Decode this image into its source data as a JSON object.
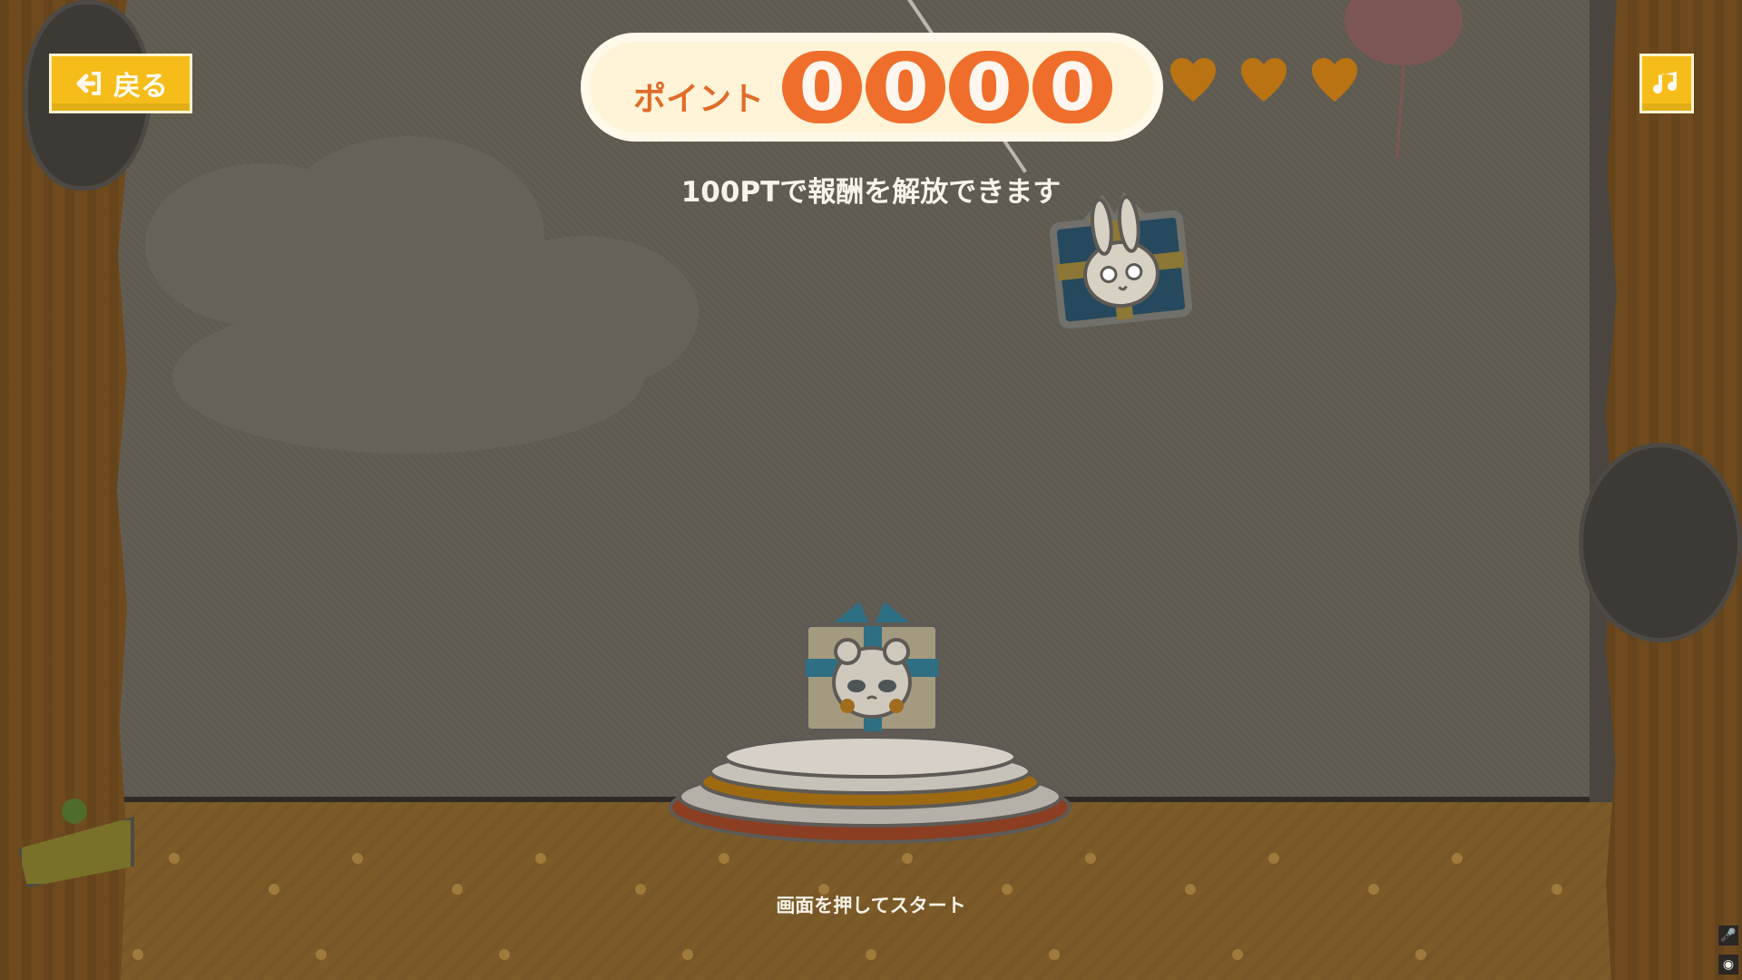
{
  "header": {
    "back_label": "戻る",
    "points_label": "ポイント",
    "points_digits": [
      "0",
      "0",
      "0",
      "0"
    ],
    "reward_hint": "100PTで報酬を解放できます"
  },
  "game": {
    "start_hint": "画面を押してスタート",
    "hearts_count": 3,
    "brand_colors": {
      "button": "#f6bd1a",
      "points": "#ef6e2c",
      "heart": "#b97312"
    }
  },
  "controls": {
    "music_icon": "music-note-icon",
    "mic_icon": "microphone-icon",
    "record_icon": "record-icon"
  }
}
